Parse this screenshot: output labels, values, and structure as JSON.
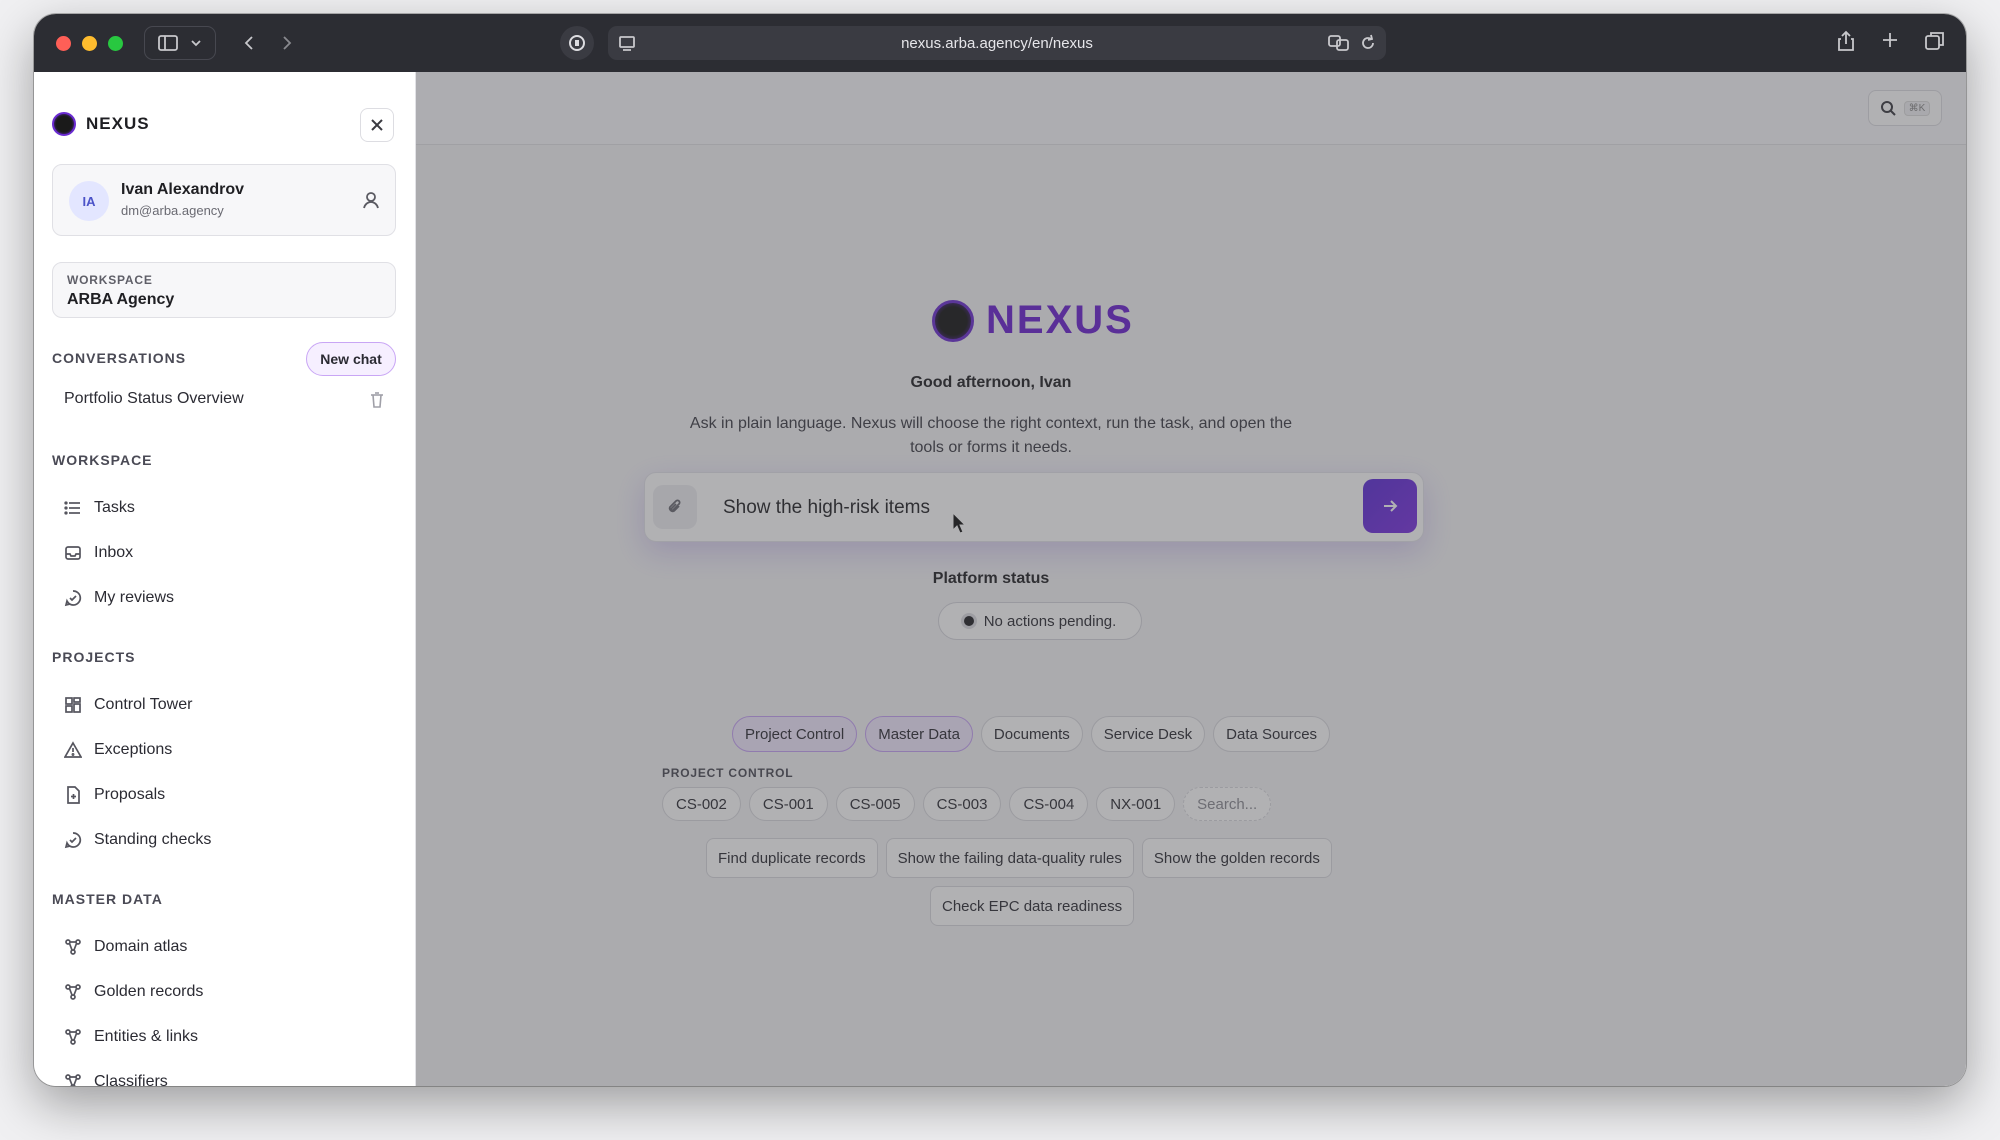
{
  "browser": {
    "url": "nexus.arba.agency/en/nexus"
  },
  "sidebar": {
    "brand": "NEXUS",
    "user": {
      "initials": "IA",
      "name": "Ivan Alexandrov",
      "email": "dm@arba.agency"
    },
    "workspace": {
      "label": "WORKSPACE",
      "name": "ARBA Agency"
    },
    "conversations": {
      "title": "CONVERSATIONS",
      "new_chat": "New chat",
      "items": [
        "Portfolio Status Overview"
      ]
    },
    "workspace_section": {
      "title": "WORKSPACE",
      "items": [
        "Tasks",
        "Inbox",
        "My reviews"
      ]
    },
    "projects_section": {
      "title": "PROJECTS",
      "items": [
        "Control Tower",
        "Exceptions",
        "Proposals",
        "Standing checks"
      ]
    },
    "master_data_section": {
      "title": "MASTER DATA",
      "items": [
        "Domain atlas",
        "Golden records",
        "Entities & links",
        "Classifiers"
      ]
    }
  },
  "main": {
    "kbd_hint": "⌘K",
    "hero_name": "NEXUS",
    "greeting": "Good afternoon, Ivan",
    "tagline": "Ask in plain language. Nexus will choose the right context, run the task, and open the tools or forms it needs.",
    "composer_value": "Show the high-risk items",
    "platform_status_title": "Platform status",
    "platform_status": "No actions pending.",
    "categories": [
      "Project Control",
      "Master Data",
      "Documents",
      "Service Desk",
      "Data Sources"
    ],
    "project_control_label": "PROJECT CONTROL",
    "projects": [
      "CS-002",
      "CS-001",
      "CS-005",
      "CS-003",
      "CS-004",
      "NX-001"
    ],
    "project_search_placeholder": "Search...",
    "suggestions": [
      "Find duplicate records",
      "Show the failing data-quality rules",
      "Show the golden records",
      "Check EPC data readiness"
    ]
  },
  "colors": {
    "brand": "#6a1fd0",
    "accent": "#5a2bd6"
  }
}
